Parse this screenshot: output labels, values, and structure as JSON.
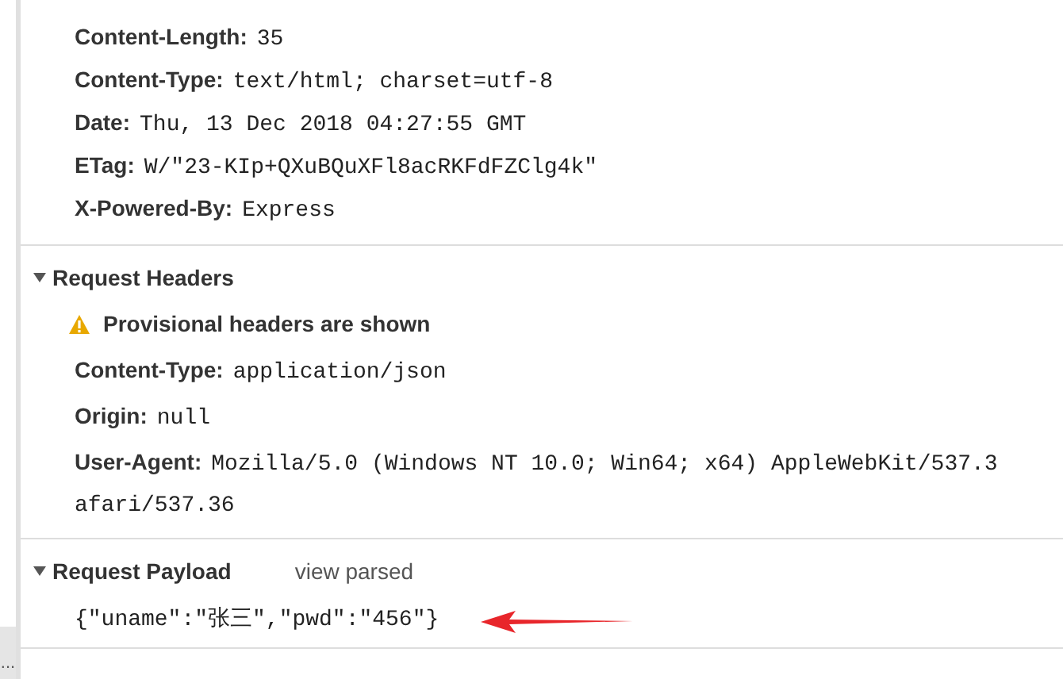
{
  "response_headers": [
    {
      "name": "Content-Length:",
      "value": "35"
    },
    {
      "name": "Content-Type:",
      "value": "text/html; charset=utf-8"
    },
    {
      "name": "Date:",
      "value": "Thu, 13 Dec 2018 04:27:55 GMT"
    },
    {
      "name": "ETag:",
      "value": "W/\"23-KIp+QXuBQuXFl8acRKFdFZClg4k\""
    },
    {
      "name": "X-Powered-By:",
      "value": "Express"
    }
  ],
  "request_headers": {
    "title": "Request Headers",
    "expanded": true,
    "warning": "Provisional headers are shown",
    "headers": [
      {
        "name": "Content-Type:",
        "value": "application/json"
      },
      {
        "name": "Origin:",
        "value": "null"
      },
      {
        "name": "User-Agent:",
        "value": "Mozilla/5.0 (Windows NT 10.0; Win64; x64) AppleWebKit/537.3",
        "continuation": "afari/537.36"
      }
    ]
  },
  "request_payload": {
    "title": "Request Payload",
    "expanded": true,
    "link": "view parsed",
    "body": "{\"uname\":\"张三\",\"pwd\":\"456\"}"
  },
  "side_tab": "..."
}
